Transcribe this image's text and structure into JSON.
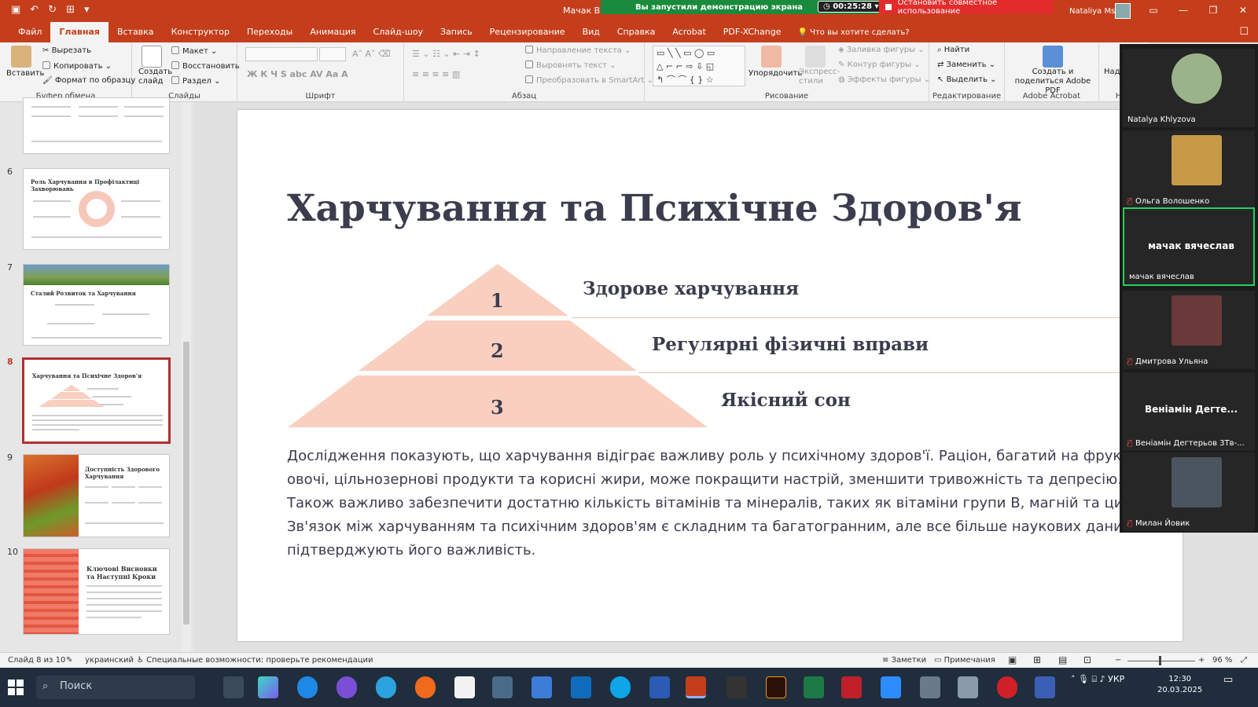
{
  "titlebar": {
    "document_title": "Мачак Вя",
    "share_message": "Вы запустили демонстрацию экрана",
    "timer": "00:25:28",
    "stop_share_label": "Остановить совместное использование",
    "user_name": "Nataliya Ms"
  },
  "menu": {
    "tabs": [
      "Файл",
      "Главная",
      "Вставка",
      "Конструктор",
      "Переходы",
      "Анимация",
      "Слайд-шоу",
      "Запись",
      "Рецензирование",
      "Вид",
      "Справка",
      "Acrobat",
      "PDF-XChange"
    ],
    "active_tab": "Главная",
    "tell_me": "Что вы хотите сделать?"
  },
  "ribbon": {
    "clipboard": {
      "paste": "Вставить",
      "cut": "Вырезать",
      "copy": "Копировать",
      "format_painter": "Формат по образцу",
      "label": "Буфер обмена"
    },
    "slides": {
      "new_slide": "Создать слайд",
      "layout": "Макет",
      "reset": "Восстановить",
      "section": "Раздел",
      "label": "Слайды"
    },
    "font": {
      "label": "Шрифт"
    },
    "paragraph": {
      "text_direction": "Направление текста",
      "align_text": "Выровнять текст",
      "smartart": "Преобразовать в SmartArt",
      "label": "Абзац"
    },
    "drawing": {
      "arrange": "Упорядочить",
      "quick_styles": "Экспресс-стили",
      "shape_fill": "Заливка фигуры",
      "shape_outline": "Контур фигуры",
      "shape_effects": "Эффекты фигуры",
      "label": "Рисование"
    },
    "editing": {
      "find": "Найти",
      "replace": "Заменить",
      "select": "Выделить",
      "label": "Редактирование"
    },
    "acrobat": {
      "create_share": "Создать и поделиться Adobe PDF",
      "label": "Adobe Acrobat"
    },
    "extra": {
      "cut_label": "Над"
    }
  },
  "thumbnails": [
    {
      "num": "",
      "title": ""
    },
    {
      "num": "6",
      "title": "Роль Харчування в Профілактиці Захворювань"
    },
    {
      "num": "7",
      "title": "Сталий Розвиток та Харчування"
    },
    {
      "num": "8",
      "title": "Харчування та Психічне Здоров'я"
    },
    {
      "num": "9",
      "title": "Доступність Здорового Харчування"
    },
    {
      "num": "10",
      "title": "Ключові Висновки та Наступні Кроки"
    }
  ],
  "slide": {
    "title": "Харчування та Психічне Здоров'я",
    "levels": [
      {
        "num": "1",
        "label": "Здорове харчування"
      },
      {
        "num": "2",
        "label": "Регулярні фізичні вправи"
      },
      {
        "num": "3",
        "label": "Якісний сон"
      }
    ],
    "body": "Дослідження показують, що харчування відіграє важливу роль у психічному здоров'ї. Раціон, багатий на фрукти, овочі, цільнозернові продукти та корисні жири, може покращити настрій, зменшити тривожність та депресію. Також важливо забезпечити достатню кількість вітамінів та мінералів, таких як вітаміни групи B, магній та цинк. Зв'язок між харчуванням та психічним здоров'ям є складним та багатогранним, але все більше наукових даних підтверджують його важливість.",
    "pyramid_color": "#f9cfc0"
  },
  "participants": [
    {
      "name": "Natalya Khlyzova",
      "big_name": "",
      "muted": false,
      "has_photo": true,
      "photo_color": "#9bb38a"
    },
    {
      "name": "Ольга Волошенко",
      "big_name": "",
      "muted": true,
      "has_photo": true,
      "photo_color": "#c89a48"
    },
    {
      "name": "мачак вячеслав",
      "big_name": "мачак вячеслав",
      "muted": false,
      "has_photo": false,
      "photo_color": ""
    },
    {
      "name": "Дмитрова Ульяна",
      "big_name": "",
      "muted": true,
      "has_photo": true,
      "photo_color": "#6a3a3a"
    },
    {
      "name": "Веніамін Дегтерьов 3Тв-...",
      "big_name": "Веніамін Дегте...",
      "muted": true,
      "has_photo": false,
      "photo_color": ""
    },
    {
      "name": "Милан Йовик",
      "big_name": "",
      "muted": true,
      "has_photo": true,
      "photo_color": "#4a5560"
    }
  ],
  "status": {
    "slide_info": "Слайд 8 из 10",
    "language": "украинский",
    "accessibility": "Специальные возможности: проверьте рекомендации",
    "notes": "Заметки",
    "comments": "Примечания",
    "zoom": "96 %"
  },
  "taskbar": {
    "search_placeholder": "Поиск",
    "lang": "УКР",
    "time": "12:30",
    "date": "20.03.2025"
  },
  "colors": {
    "accent": "#c43e1c",
    "share_green": "#1a8a3c",
    "stop_red": "#e22c2c"
  }
}
